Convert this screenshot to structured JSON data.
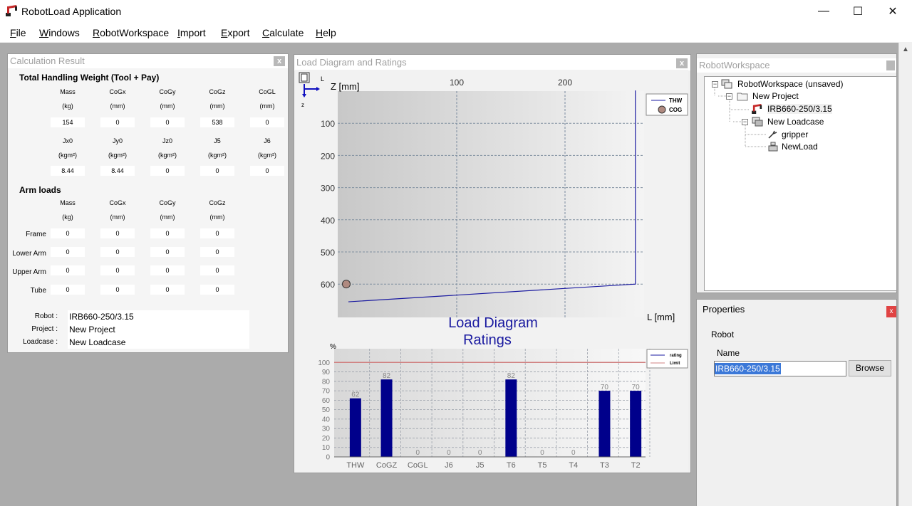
{
  "window": {
    "title": "RobotLoad Application",
    "minimize": "—",
    "maximize": "☐",
    "close": "✕"
  },
  "menu": [
    "File",
    "Windows",
    "RobotWorkspace",
    "Import",
    "Export",
    "Calculate",
    "Help"
  ],
  "calc": {
    "panel_title": "Calculation Result",
    "close": "x",
    "thw_title": "Total Handling Weight (Tool + Pay)",
    "thw_row1_labels": [
      [
        "Mass",
        "(kg)"
      ],
      [
        "CoGx",
        "(mm)"
      ],
      [
        "CoGy",
        "(mm)"
      ],
      [
        "CoGz",
        "(mm)"
      ],
      [
        "CoGL",
        "(mm)"
      ]
    ],
    "thw_row1_values": [
      "154",
      "0",
      "0",
      "538",
      "0"
    ],
    "thw_row2_labels": [
      [
        "Jx0",
        "(kgm²)"
      ],
      [
        "Jy0",
        "(kgm²)"
      ],
      [
        "Jz0",
        "(kgm²)"
      ],
      [
        "J5",
        "(kgm²)"
      ],
      [
        "J6",
        "(kgm²)"
      ]
    ],
    "thw_row2_values": [
      "8.44",
      "8.44",
      "0",
      "0",
      "0"
    ],
    "arm_title": "Arm loads",
    "arm_labels": [
      [
        "Mass",
        "(kg)"
      ],
      [
        "CoGx",
        "(mm)"
      ],
      [
        "CoGy",
        "(mm)"
      ],
      [
        "CoGz",
        "(mm)"
      ]
    ],
    "arm_rows": [
      {
        "name": "Frame",
        "values": [
          "0",
          "0",
          "0",
          "0"
        ]
      },
      {
        "name": "Lower Arm",
        "values": [
          "0",
          "0",
          "0",
          "0"
        ]
      },
      {
        "name": "Upper Arm",
        "values": [
          "0",
          "0",
          "0",
          "0"
        ]
      },
      {
        "name": "Tube",
        "values": [
          "0",
          "0",
          "0",
          "0"
        ]
      }
    ],
    "info": {
      "robot_label": "Robot :",
      "robot_value": "IRB660-250/3.15",
      "project_label": "Project :",
      "project_value": "New Project",
      "loadcase_label": "Loadcase :",
      "loadcase_value": "New Loadcase"
    }
  },
  "diagram": {
    "panel_title": "Load Diagram and Ratings",
    "close": "x",
    "axis_icon_l": "L",
    "axis_icon_z": "z",
    "z_axis_label": "Z [mm]",
    "l_axis_label": "L [mm]",
    "ratings_title_line1": "Load Diagram",
    "ratings_title_line2": "Ratings",
    "percent_label": "%",
    "legend_thw": "THW",
    "legend_cog": "COG",
    "legend_rating": "rating",
    "legend_limit": "Limit",
    "colors": {
      "line": "#1a1aa0",
      "bar": "#00008b",
      "limit": "#d08080",
      "cog": "#b08a80"
    }
  },
  "chart_data": [
    {
      "type": "line",
      "x_ticks": [
        100,
        200
      ],
      "y_ticks": [
        100,
        200,
        300,
        400,
        500,
        600
      ],
      "xlabel": "L [mm]",
      "ylabel": "Z [mm]",
      "y_inverted": true,
      "series": [
        {
          "name": "THW",
          "points": [
            [
              0,
              655
            ],
            [
              265,
              600
            ],
            [
              265,
              -2
            ]
          ]
        },
        {
          "name": "COG",
          "points": [
            [
              0,
              538
            ]
          ]
        }
      ],
      "legend": "top-right"
    },
    {
      "type": "bar",
      "title": "Load Diagram Ratings",
      "ylabel": "%",
      "categories": [
        "THW",
        "CoGZ",
        "CoGL",
        "J6",
        "J5",
        "T6",
        "T5",
        "T4",
        "T3",
        "T2"
      ],
      "y_ticks": [
        0,
        10,
        20,
        30,
        40,
        50,
        60,
        70,
        80,
        90,
        100
      ],
      "ylim": [
        0,
        110
      ],
      "series": [
        {
          "name": "rating",
          "values": [
            62,
            82,
            0,
            0,
            0,
            82,
            0,
            0,
            70,
            70
          ]
        },
        {
          "name": "Limit",
          "values": [
            100,
            100,
            100,
            100,
            100,
            100,
            100,
            100,
            100,
            100
          ]
        }
      ],
      "legend": "top-right"
    }
  ],
  "workspace": {
    "panel_title": "RobotWorkspace",
    "tree": [
      {
        "label": "RobotWorkspace (unsaved)",
        "level": 0
      },
      {
        "label": "New Project",
        "level": 1
      },
      {
        "label": "IRB660-250/3.15",
        "level": 2
      },
      {
        "label": "New Loadcase",
        "level": 2
      },
      {
        "label": "gripper",
        "level": 3
      },
      {
        "label": "NewLoad",
        "level": 3
      }
    ]
  },
  "properties": {
    "panel_title": "Properties",
    "close": "x",
    "group_label": "Robot",
    "name_label": "Name",
    "name_value": "IRB660-250/3.15",
    "browse_label": "Browse"
  }
}
